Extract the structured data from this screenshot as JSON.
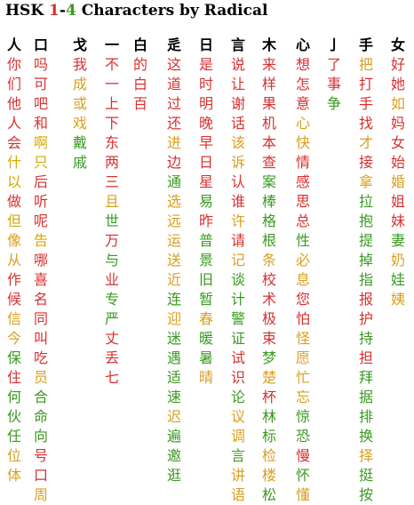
{
  "title": {
    "prefix": "HSK ",
    "level_start": "1",
    "dash": "-",
    "level_end": "4",
    "suffix": " Characters by Radical"
  },
  "colors": {
    "hsk1": "#d83030",
    "hsk2": "#d4a800",
    "hsk3": "#d8a020",
    "hsk4": "#3a9a20",
    "header": "#000000",
    "dash": "#000000"
  },
  "columns": [
    {
      "radical": "人",
      "chars": [
        [
          "你",
          1
        ],
        [
          "们",
          1
        ],
        [
          "他",
          1
        ],
        [
          "人",
          1
        ],
        [
          "会",
          1
        ],
        [
          "什",
          2
        ],
        [
          "以",
          2
        ],
        [
          "做",
          1
        ],
        [
          "但",
          2
        ],
        [
          "像",
          3
        ],
        [
          "从",
          3
        ],
        [
          "作",
          1
        ],
        [
          "候",
          1
        ],
        [
          "信",
          3
        ],
        [
          "今",
          3
        ],
        [
          "保",
          4
        ],
        [
          "住",
          1
        ],
        [
          "何",
          4
        ],
        [
          "伙",
          4
        ],
        [
          "任",
          4
        ],
        [
          "位",
          3
        ],
        [
          "体",
          3
        ]
      ]
    },
    {
      "radical": "口",
      "chars": [
        [
          "吗",
          1
        ],
        [
          "可",
          1
        ],
        [
          "吧",
          1
        ],
        [
          "和",
          1
        ],
        [
          "啊",
          2
        ],
        [
          "只",
          2
        ],
        [
          "后",
          1
        ],
        [
          "听",
          1
        ],
        [
          "呢",
          1
        ],
        [
          "告",
          2
        ],
        [
          "哪",
          1
        ],
        [
          "喜",
          1
        ],
        [
          "名",
          1
        ],
        [
          "同",
          1
        ],
        [
          "叫",
          1
        ],
        [
          "吃",
          1
        ],
        [
          "员",
          3
        ],
        [
          "合",
          4
        ],
        [
          "命",
          4
        ],
        [
          "向",
          4
        ],
        [
          "号",
          1
        ],
        [
          "口",
          1
        ],
        [
          "周",
          3
        ]
      ]
    },
    {
      "radical": "戈",
      "chars": [
        [
          "我",
          1
        ],
        [
          "成",
          3
        ],
        [
          "或",
          3
        ],
        [
          "戏",
          3
        ],
        [
          "戴",
          4
        ],
        [
          "戚",
          4
        ]
      ]
    },
    {
      "radical": "一",
      "chars": [
        [
          "不",
          1
        ],
        [
          "一",
          1
        ],
        [
          "上",
          1
        ],
        [
          "下",
          1
        ],
        [
          "东",
          1
        ],
        [
          "两",
          1
        ],
        [
          "三",
          1
        ],
        [
          "且",
          3
        ],
        [
          "世",
          4
        ],
        [
          "万",
          1
        ],
        [
          "与",
          4
        ],
        [
          "业",
          1
        ],
        [
          "专",
          4
        ],
        [
          "严",
          4
        ],
        [
          "丈",
          1
        ],
        [
          "丢",
          1
        ],
        [
          "七",
          1
        ]
      ]
    },
    {
      "radical": "白",
      "chars": [
        [
          "的",
          1
        ],
        [
          "白",
          1
        ],
        [
          "百",
          1
        ]
      ]
    },
    {
      "radical": "辵",
      "chars": [
        [
          "这",
          1
        ],
        [
          "道",
          1
        ],
        [
          "过",
          1
        ],
        [
          "还",
          1
        ],
        [
          "进",
          3
        ],
        [
          "边",
          1
        ],
        [
          "通",
          4
        ],
        [
          "选",
          3
        ],
        [
          "远",
          3
        ],
        [
          "运",
          3
        ],
        [
          "送",
          3
        ],
        [
          "近",
          3
        ],
        [
          "连",
          4
        ],
        [
          "迎",
          3
        ],
        [
          "迷",
          4
        ],
        [
          "遇",
          4
        ],
        [
          "适",
          4
        ],
        [
          "速",
          4
        ],
        [
          "迟",
          3
        ],
        [
          "遍",
          4
        ],
        [
          "邀",
          4
        ],
        [
          "逛",
          4
        ]
      ]
    },
    {
      "radical": "日",
      "chars": [
        [
          "是",
          1
        ],
        [
          "时",
          1
        ],
        [
          "明",
          1
        ],
        [
          "晚",
          1
        ],
        [
          "早",
          1
        ],
        [
          "日",
          1
        ],
        [
          "星",
          1
        ],
        [
          "易",
          4
        ],
        [
          "昨",
          1
        ],
        [
          "普",
          4
        ],
        [
          "景",
          4
        ],
        [
          "旧",
          4
        ],
        [
          "暂",
          4
        ],
        [
          "春",
          3
        ],
        [
          "暖",
          4
        ],
        [
          "暑",
          4
        ],
        [
          "晴",
          3
        ]
      ]
    },
    {
      "radical": "言",
      "chars": [
        [
          "说",
          1
        ],
        [
          "让",
          1
        ],
        [
          "谢",
          1
        ],
        [
          "话",
          1
        ],
        [
          "该",
          3
        ],
        [
          "诉",
          3
        ],
        [
          "认",
          1
        ],
        [
          "谁",
          1
        ],
        [
          "许",
          3
        ],
        [
          "请",
          1
        ],
        [
          "记",
          3
        ],
        [
          "谈",
          4
        ],
        [
          "计",
          4
        ],
        [
          "警",
          4
        ],
        [
          "证",
          4
        ],
        [
          "试",
          1
        ],
        [
          "识",
          1
        ],
        [
          "论",
          4
        ],
        [
          "议",
          3
        ],
        [
          "调",
          3
        ],
        [
          "言",
          4
        ],
        [
          "讲",
          3
        ],
        [
          "语",
          3
        ]
      ]
    },
    {
      "radical": "木",
      "chars": [
        [
          "来",
          1
        ],
        [
          "样",
          1
        ],
        [
          "果",
          1
        ],
        [
          "机",
          1
        ],
        [
          "本",
          1
        ],
        [
          "查",
          1
        ],
        [
          "案",
          4
        ],
        [
          "棒",
          4
        ],
        [
          "格",
          4
        ],
        [
          "根",
          4
        ],
        [
          "条",
          3
        ],
        [
          "校",
          1
        ],
        [
          "术",
          1
        ],
        [
          "极",
          1
        ],
        [
          "束",
          1
        ],
        [
          "梦",
          4
        ],
        [
          "楚",
          3
        ],
        [
          "杯",
          1
        ],
        [
          "林",
          4
        ],
        [
          "标",
          4
        ],
        [
          "检",
          3
        ],
        [
          "楼",
          3
        ],
        [
          "松",
          4
        ]
      ]
    },
    {
      "radical": "心",
      "chars": [
        [
          "想",
          1
        ],
        [
          "怎",
          1
        ],
        [
          "意",
          1
        ],
        [
          "心",
          3
        ],
        [
          "快",
          3
        ],
        [
          "情",
          1
        ],
        [
          "感",
          1
        ],
        [
          "思",
          1
        ],
        [
          "总",
          1
        ],
        [
          "性",
          4
        ],
        [
          "必",
          3
        ],
        [
          "息",
          3
        ],
        [
          "您",
          1
        ],
        [
          "怕",
          1
        ],
        [
          "怪",
          3
        ],
        [
          "愿",
          3
        ],
        [
          "忙",
          3
        ],
        [
          "忘",
          3
        ],
        [
          "惊",
          4
        ],
        [
          "恐",
          4
        ],
        [
          "慢",
          1
        ],
        [
          "怀",
          4
        ],
        [
          "懂",
          3
        ]
      ]
    },
    {
      "radical": "亅",
      "chars": [
        [
          "了",
          1
        ],
        [
          "事",
          1
        ],
        [
          "争",
          4
        ]
      ]
    },
    {
      "radical": "手",
      "chars": [
        [
          "把",
          3
        ],
        [
          "打",
          1
        ],
        [
          "手",
          1
        ],
        [
          "找",
          1
        ],
        [
          "才",
          3
        ],
        [
          "接",
          1
        ],
        [
          "拿",
          3
        ],
        [
          "拉",
          4
        ],
        [
          "抱",
          4
        ],
        [
          "提",
          4
        ],
        [
          "掉",
          4
        ],
        [
          "指",
          4
        ],
        [
          "报",
          1
        ],
        [
          "护",
          1
        ],
        [
          "持",
          4
        ],
        [
          "担",
          1
        ],
        [
          "拜",
          4
        ],
        [
          "据",
          4
        ],
        [
          "排",
          4
        ],
        [
          "换",
          4
        ],
        [
          "择",
          3
        ],
        [
          "挺",
          4
        ],
        [
          "按",
          4
        ]
      ]
    },
    {
      "radical": "女",
      "chars": [
        [
          "好",
          1
        ],
        [
          "她",
          1
        ],
        [
          "如",
          3
        ],
        [
          "妈",
          1
        ],
        [
          "女",
          1
        ],
        [
          "始",
          1
        ],
        [
          "婚",
          3
        ],
        [
          "姐",
          1
        ],
        [
          "妹",
          1
        ],
        [
          "妻",
          4
        ],
        [
          "奶",
          3
        ],
        [
          "娃",
          4
        ],
        [
          "姨",
          3
        ]
      ]
    }
  ]
}
